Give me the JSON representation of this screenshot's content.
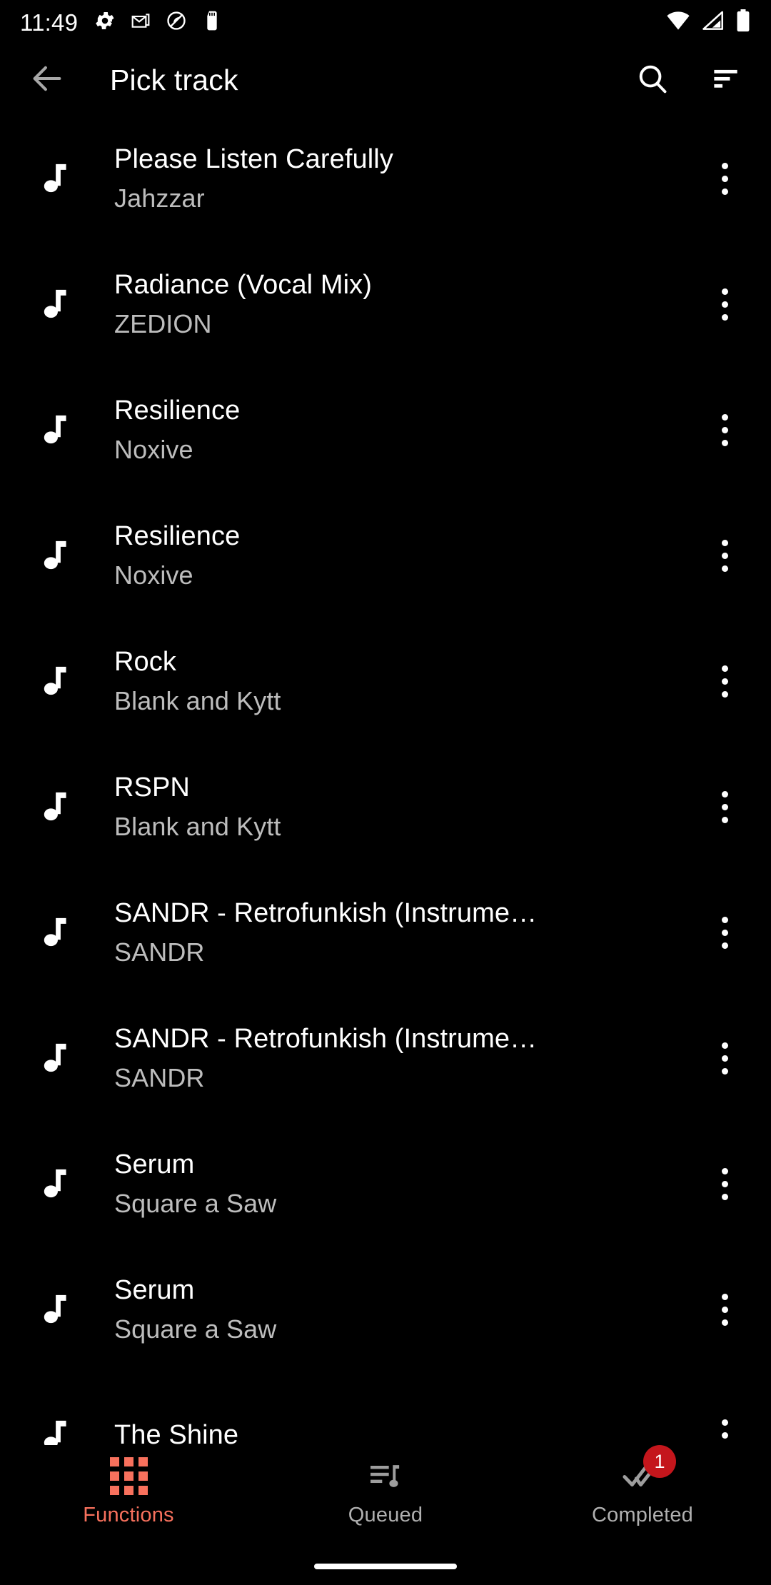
{
  "status_bar": {
    "time": "11:49",
    "left_icons": [
      "gear-icon",
      "gmail-icon",
      "circle-slash-icon",
      "sd-card-icon"
    ],
    "right_icons": [
      "wifi-icon",
      "cell-signal-icon",
      "battery-icon"
    ]
  },
  "toolbar": {
    "back_label": "back-arrow-icon",
    "title": "Pick track",
    "search_label": "search-icon",
    "sort_label": "sort-icon"
  },
  "list": {
    "item_icon": "music-note-icon",
    "overflow_label": "overflow-menu-icon",
    "tracks": [
      {
        "title": "Please Listen Carefully",
        "artist": "Jahzzar"
      },
      {
        "title": "Radiance (Vocal Mix)",
        "artist": "ZEDION"
      },
      {
        "title": "Resilience",
        "artist": "Noxive"
      },
      {
        "title": "Resilience",
        "artist": "Noxive"
      },
      {
        "title": "Rock",
        "artist": "Blank and Kytt"
      },
      {
        "title": "RSPN",
        "artist": "Blank and Kytt"
      },
      {
        "title": "SANDR - Retrofunkish (Instrume…",
        "artist": "SANDR"
      },
      {
        "title": "SANDR - Retrofunkish (Instrume…",
        "artist": "SANDR"
      },
      {
        "title": "Serum",
        "artist": "Square a Saw"
      },
      {
        "title": "Serum",
        "artist": "Square a Saw"
      },
      {
        "title": "The Shine",
        "artist": ""
      }
    ]
  },
  "bottom_nav": {
    "items": [
      {
        "label": "Functions",
        "icon": "grid-icon",
        "active": true,
        "badge": ""
      },
      {
        "label": "Queued",
        "icon": "playlist-music-icon",
        "active": false,
        "badge": ""
      },
      {
        "label": "Completed",
        "icon": "double-check-icon",
        "active": false,
        "badge": "1"
      }
    ]
  },
  "colors": {
    "background": "#000000",
    "accent": "#f8715d",
    "badge": "#c4161c",
    "primary_text": "#ffffff",
    "secondary_text": "#bdbdbd",
    "inactive_nav": "#b0b0b0"
  }
}
